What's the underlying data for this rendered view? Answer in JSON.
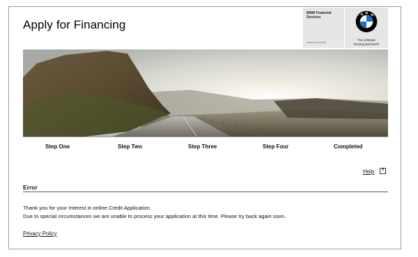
{
  "page": {
    "title": "Apply for Financing"
  },
  "brand": {
    "financial_services": "BMW Financial Services",
    "url": "bmwusa.com/fs",
    "tagline_line1": "The Ultimate",
    "tagline_line2": "Driving Machine®",
    "logo_letters": "BMW",
    "colors": {
      "blue": "#1c69d4",
      "black": "#000000",
      "panel": "#e6e6e6"
    }
  },
  "banner": {
    "image": "desert-road-sunrise"
  },
  "steps": [
    "Step One",
    "Step Two",
    "Step Three",
    "Step Four",
    "Completed"
  ],
  "help": {
    "label": "Help",
    "icon": "?"
  },
  "error": {
    "heading": "Error",
    "line1": "Thank you for your interest in online Credit Application.",
    "line2": "Due to special circumstances we are unable to process your application at this time. Please try back again soon."
  },
  "footer": {
    "privacy_label": "Privacy Policy"
  }
}
